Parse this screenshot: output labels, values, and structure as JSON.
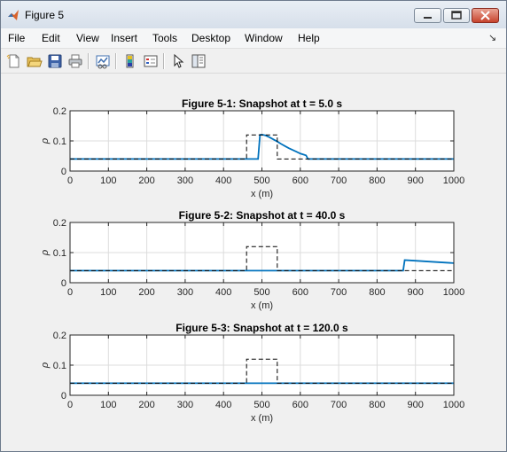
{
  "window": {
    "title": "Figure 5",
    "controls": [
      "minimize",
      "maximize",
      "close"
    ]
  },
  "menubar": {
    "items": [
      "File",
      "Edit",
      "View",
      "Insert",
      "Tools",
      "Desktop",
      "Window",
      "Help"
    ]
  },
  "toolbar": {
    "icons": [
      "new-figure-icon",
      "open-file-icon",
      "save-icon",
      "print-icon",
      "link-plot-icon",
      "colorbar-icon",
      "legend-icon",
      "select-arrow-icon",
      "property-editor-icon"
    ]
  },
  "colors": {
    "series": "#0072bd",
    "reference": "#000000",
    "grid": "#dcdcdc",
    "axes": "#262626"
  },
  "chart_data": [
    {
      "type": "line",
      "title": "Figure 5-1: Snapshot at t = 5.0 s",
      "xlabel": "x (m)",
      "ylabel": "ρ",
      "xlim": [
        0,
        1000
      ],
      "ylim": [
        0,
        0.2
      ],
      "xticks": [
        0,
        100,
        200,
        300,
        400,
        500,
        600,
        700,
        800,
        900,
        1000
      ],
      "yticks": [
        0,
        0.1,
        0.2
      ],
      "grid": true,
      "series": [
        {
          "style": "solid",
          "x": [
            0,
            490,
            495,
            500,
            510,
            520,
            530,
            540,
            550,
            560,
            570,
            580,
            590,
            600,
            610,
            615,
            620,
            1000
          ],
          "y": [
            0.04,
            0.04,
            0.12,
            0.121,
            0.118,
            0.112,
            0.105,
            0.098,
            0.09,
            0.083,
            0.076,
            0.07,
            0.064,
            0.058,
            0.054,
            0.052,
            0.04,
            0.04
          ]
        },
        {
          "style": "dashed",
          "x": [
            0,
            460,
            460,
            540,
            540,
            1000
          ],
          "y": [
            0.04,
            0.04,
            0.12,
            0.12,
            0.04,
            0.04
          ]
        }
      ]
    },
    {
      "type": "line",
      "title": "Figure 5-2: Snapshot at t = 40.0 s",
      "xlabel": "x (m)",
      "ylabel": "ρ",
      "xlim": [
        0,
        1000
      ],
      "ylim": [
        0,
        0.2
      ],
      "xticks": [
        0,
        100,
        200,
        300,
        400,
        500,
        600,
        700,
        800,
        900,
        1000
      ],
      "yticks": [
        0,
        0.1,
        0.2
      ],
      "grid": true,
      "series": [
        {
          "style": "solid",
          "x": [
            0,
            868,
            872,
            900,
            950,
            1000
          ],
          "y": [
            0.04,
            0.04,
            0.075,
            0.073,
            0.069,
            0.065
          ]
        },
        {
          "style": "dashed",
          "x": [
            0,
            460,
            460,
            540,
            540,
            1000
          ],
          "y": [
            0.04,
            0.04,
            0.12,
            0.12,
            0.04,
            0.04
          ]
        }
      ]
    },
    {
      "type": "line",
      "title": "Figure 5-3: Snapshot at t = 120.0 s",
      "xlabel": "x (m)",
      "ylabel": "ρ",
      "xlim": [
        0,
        1000
      ],
      "ylim": [
        0,
        0.2
      ],
      "xticks": [
        0,
        100,
        200,
        300,
        400,
        500,
        600,
        700,
        800,
        900,
        1000
      ],
      "yticks": [
        0,
        0.1,
        0.2
      ],
      "grid": true,
      "series": [
        {
          "style": "solid",
          "x": [
            0,
            1000
          ],
          "y": [
            0.04,
            0.04
          ]
        },
        {
          "style": "dashed",
          "x": [
            0,
            460,
            460,
            540,
            540,
            1000
          ],
          "y": [
            0.04,
            0.04,
            0.12,
            0.12,
            0.04,
            0.04
          ]
        }
      ]
    }
  ]
}
